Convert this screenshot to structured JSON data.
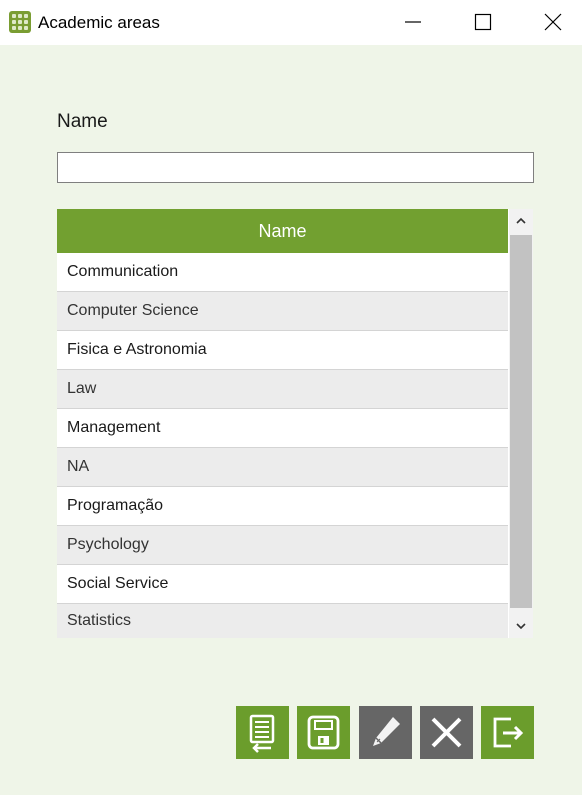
{
  "window": {
    "title": "Academic areas",
    "icons": {
      "app": "grid-app-icon",
      "minimize": "minimize-icon",
      "maximize": "maximize-icon",
      "close": "close-icon"
    }
  },
  "form": {
    "name_label": "Name",
    "name_value": "",
    "name_placeholder": ""
  },
  "grid": {
    "column_header": "Name",
    "rows": [
      "Communication",
      "Computer Science",
      "Fisica e Astronomia",
      "Law",
      "Management",
      "NA",
      "Programação",
      "Psychology",
      "Social Service",
      "Statistics"
    ]
  },
  "toolbar": {
    "buttons": [
      {
        "id": "import",
        "icon": "import-list-icon",
        "enabled": true
      },
      {
        "id": "save",
        "icon": "save-icon",
        "enabled": true
      },
      {
        "id": "edit",
        "icon": "pencil-icon",
        "enabled": false
      },
      {
        "id": "delete",
        "icon": "x-delete-icon",
        "enabled": false
      },
      {
        "id": "exit",
        "icon": "exit-icon",
        "enabled": true
      }
    ]
  },
  "colors": {
    "accent_green": "#72a030",
    "button_green": "#6b9d2c",
    "button_disabled": "#666666",
    "client_background": "#eff5e8",
    "row_alt": "#ececec"
  }
}
